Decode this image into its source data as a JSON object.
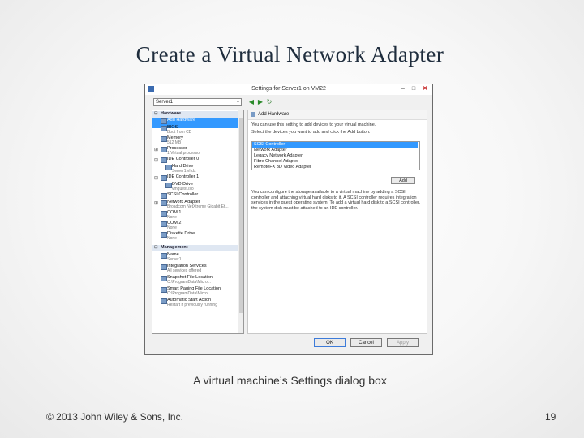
{
  "slide": {
    "title": "Create a Virtual Network Adapter",
    "caption": "A virtual machine’s Settings dialog box",
    "copyright": "© 2013 John Wiley & Sons, Inc.",
    "page_number": "19"
  },
  "dialog": {
    "title": "Settings for Server1 on VM22",
    "controls": {
      "minimize": "–",
      "maximize": "□",
      "close": "✕"
    },
    "vm_select_value": "Server1",
    "tree": {
      "hardware_header": "Hardware",
      "items": [
        {
          "label": "Add Hardware",
          "sub": "",
          "selected": true
        },
        {
          "label": "BIOS",
          "sub": "Boot from CD"
        },
        {
          "label": "Memory",
          "sub": "512 MB"
        },
        {
          "label": "Processor",
          "sub": "1 Virtual processor"
        },
        {
          "label": "IDE Controller 0",
          "sub": ""
        },
        {
          "label": "Hard Drive",
          "sub": "Server1.vhdx"
        },
        {
          "label": "IDE Controller 1",
          "sub": ""
        },
        {
          "label": "DVD Drive",
          "sub": "vmguest.iso"
        },
        {
          "label": "SCSI Controller",
          "sub": ""
        },
        {
          "label": "Network Adapter",
          "sub": "Broadcom NetXtreme Gigabit Et..."
        },
        {
          "label": "COM 1",
          "sub": "None"
        },
        {
          "label": "COM 2",
          "sub": "None"
        },
        {
          "label": "Diskette Drive",
          "sub": "None"
        }
      ],
      "management_header": "Management",
      "management_items": [
        {
          "label": "Name",
          "sub": "Server1"
        },
        {
          "label": "Integration Services",
          "sub": "All services offered"
        },
        {
          "label": "Snapshot File Location",
          "sub": "C:\\ProgramData\\Micro..."
        },
        {
          "label": "Smart Paging File Location",
          "sub": "C:\\ProgramData\\Micro..."
        },
        {
          "label": "Automatic Start Action",
          "sub": "Restart if previously running"
        }
      ]
    },
    "right": {
      "header": "Add Hardware",
      "intro1": "You can use this setting to add devices to your virtual machine.",
      "intro2": "Select the devices you want to add and click the Add button.",
      "devices": [
        {
          "label": "SCSI Controller",
          "selected": true
        },
        {
          "label": "Network Adapter"
        },
        {
          "label": "Legacy Network Adapter"
        },
        {
          "label": "Fibre Channel Adapter"
        },
        {
          "label": "RemoteFX 3D Video Adapter"
        }
      ],
      "add_button": "Add",
      "desc": "You can configure the storage available to a virtual machine by adding a SCSI controller and attaching virtual hard disks to it. A SCSI controller requires integration services in the guest operating system. To add a virtual hard disk to a SCSI controller, the system disk must be attached to an IDE controller."
    },
    "buttons": {
      "ok": "OK",
      "cancel": "Cancel",
      "apply": "Apply"
    }
  }
}
